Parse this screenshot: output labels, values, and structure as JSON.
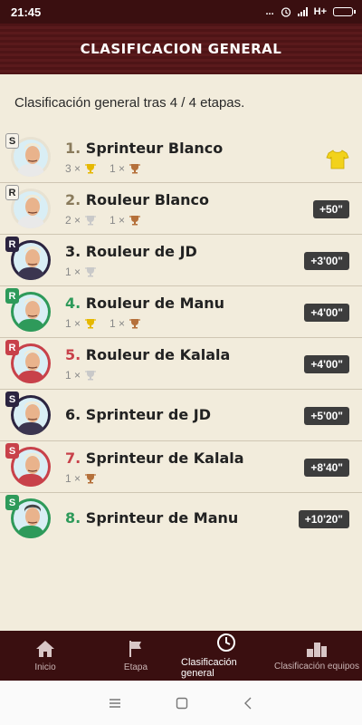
{
  "status": {
    "time": "21:45",
    "dots": "...",
    "network": "H+"
  },
  "header": {
    "title": "CLASIFICACION GENERAL"
  },
  "subtitle": "Clasificación general tras 4 / 4 etapas.",
  "colors": {
    "white": "#ffffff",
    "black": "#2b2440",
    "red": "#c8414a",
    "green": "#2e9a5a",
    "accent": "#3a0f10"
  },
  "riders": [
    {
      "pos": "1.",
      "name": "Sprinteur Blanco",
      "type": "S",
      "team": "white",
      "gold": "3",
      "silver": "",
      "bronze": "1",
      "gap": "",
      "jersey": true
    },
    {
      "pos": "2.",
      "name": "Rouleur Blanco",
      "type": "R",
      "team": "white",
      "gold": "",
      "silver": "2",
      "bronze": "1",
      "gap": "+50\"",
      "jersey": false
    },
    {
      "pos": "3.",
      "name": "Rouleur de JD",
      "type": "R",
      "team": "black",
      "gold": "",
      "silver": "1",
      "bronze": "",
      "gap": "+3'00\"",
      "jersey": false
    },
    {
      "pos": "4.",
      "name": "Rouleur de Manu",
      "type": "R",
      "team": "green",
      "gold": "1",
      "silver": "",
      "bronze": "1",
      "gap": "+4'00\"",
      "jersey": false
    },
    {
      "pos": "5.",
      "name": "Rouleur de Kalala",
      "type": "R",
      "team": "red",
      "gold": "",
      "silver": "1",
      "bronze": "",
      "gap": "+4'00\"",
      "jersey": false
    },
    {
      "pos": "6.",
      "name": "Sprinteur de JD",
      "type": "S",
      "team": "black",
      "gold": "",
      "silver": "",
      "bronze": "",
      "gap": "+5'00\"",
      "jersey": false
    },
    {
      "pos": "7.",
      "name": "Sprinteur de Kalala",
      "type": "S",
      "team": "red",
      "gold": "",
      "silver": "",
      "bronze": "1",
      "gap": "+8'40\"",
      "jersey": false
    },
    {
      "pos": "8.",
      "name": "Sprinteur de Manu",
      "type": "S",
      "team": "green",
      "gold": "",
      "silver": "",
      "bronze": "",
      "gap": "+10'20\"",
      "jersey": false
    }
  ],
  "nav": [
    {
      "label": "Inicio",
      "icon": "home-icon"
    },
    {
      "label": "Etapa",
      "icon": "flag-icon"
    },
    {
      "label": "Clasificación general",
      "icon": "clock-icon",
      "active": true
    },
    {
      "label": "Clasificación equipos",
      "icon": "podium-icon"
    }
  ],
  "system_nav": [
    "menu-icon",
    "home-square-icon",
    "back-icon"
  ]
}
